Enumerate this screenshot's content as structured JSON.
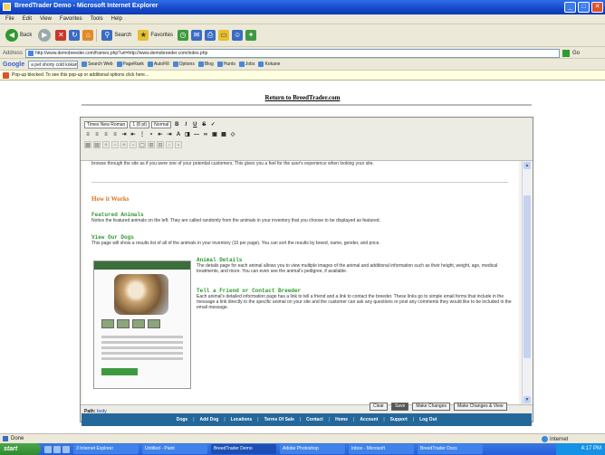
{
  "window": {
    "title": "BreedTrader Demo - Microsoft Internet Explorer",
    "controls": [
      "_",
      "□",
      "✕"
    ]
  },
  "menu": [
    "File",
    "Edit",
    "View",
    "Favorites",
    "Tools",
    "Help"
  ],
  "toolbar": {
    "back_label": "Back",
    "search_label": "Search",
    "favorites_label": "Favorites"
  },
  "address": {
    "label": "Address",
    "url": "http://www.demobreeder.com/frames.php?url=http://www.demobreeder.com/index.php",
    "go_label": "Go"
  },
  "google_bar": {
    "logo": "Google",
    "query": "a pet shorty cold kokane",
    "search_label": "Search Web",
    "items": [
      "PageRank",
      "AutoFill",
      "Options",
      "Blog",
      "Hunts",
      "Jobs",
      "Kokane"
    ]
  },
  "infobar": {
    "text": "Pop-up blocked. To see this pop-up or additional options click here..."
  },
  "page": {
    "return_link": "Return to BreedTrader.com",
    "intro_text": "browse through the site as if you were one of your potential customers. This gives you a feel for the user's experience when looking your site.",
    "how_it_works": "How it Works",
    "featured_heading": "Featured Animals",
    "featured_text": "Notice the featured animals on the left. They are called randomly from the animals in your inventory that you choose to be displayed as featured.",
    "view_dogs_heading": "View Our Dogs",
    "view_dogs_text": "This page will show a results list of all of the animals in your inventory (10 per page). You can sort the results by breed, name, gender, and price.",
    "animal_details_heading": "Animal Details",
    "animal_details_text": "The details page for each animal allows you to view multiple images of the animal and additional information such as their height, weight, age, medical treatments, and more. You can even see the animal's pedigree, if available.",
    "tell_friend_heading": "Tell a Friend or Contact Breeder",
    "tell_friend_text": "Each animal's detailed information page has a link to tell a friend and a link to contact the breeder. These links go to simple email forms that include in the message a link directly to the specific animal on your site and the customer can ask any questions or post any comments they would like to be included in the email message."
  },
  "editor": {
    "font_select": "Times New Roman",
    "size_select": "1 (8 pt)",
    "style_select": "Normal",
    "path_label": "Path:",
    "path_value": "body"
  },
  "form_buttons": [
    "Clear",
    "Save",
    "Make Changes",
    "Make Changes & View"
  ],
  "nav": [
    "Dogs",
    "Add Dog",
    "Locations",
    "Terms Of Sale",
    "Contact",
    "Home",
    "Account",
    "Support",
    "Log Out"
  ],
  "status": {
    "text": "Done",
    "zone": "Internet"
  },
  "taskbar": {
    "start": "start",
    "tasks": [
      "3 Internet Explorer",
      "Untitled - Paint",
      "BreedTrader Demo",
      "Adobe Photoshop",
      "Inbox - Microsoft",
      "BreedTrader Docs"
    ],
    "clock": "4:17 PM"
  }
}
